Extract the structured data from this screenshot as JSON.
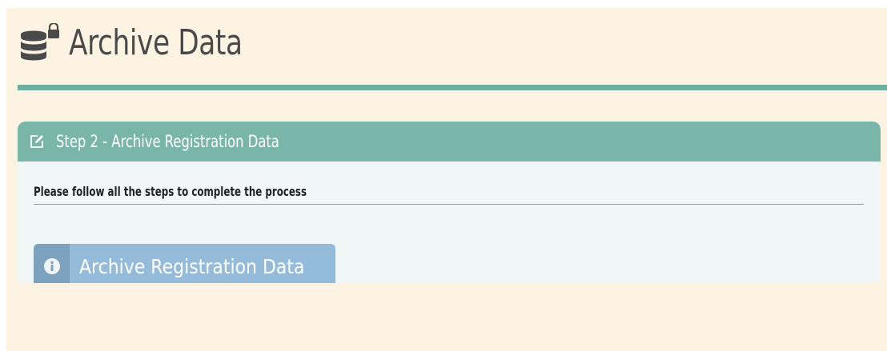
{
  "header": {
    "title": "Archive Data",
    "icon": "locked-database-icon"
  },
  "panel": {
    "title": "Step 2 - Archive Registration Data",
    "header_icon": "edit-icon",
    "instructions": "Please follow all the steps to complete the process",
    "button": {
      "label": "Archive Registration Data",
      "icon": "info-circle-icon"
    }
  },
  "colors": {
    "page_background": "#fdf3e3",
    "accent_teal": "#6fb1a0",
    "panel_header": "#79b6a9",
    "panel_body": "#f1f7f6",
    "button": "#95bbdb",
    "button_icon_box": "#7da2bf",
    "title_text": "#4a4a4a"
  }
}
